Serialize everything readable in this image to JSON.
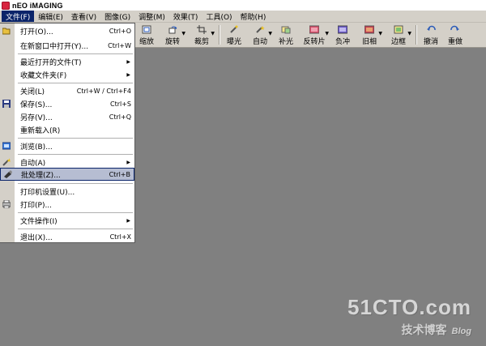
{
  "app": {
    "title": "nEO iMAGING"
  },
  "menubar": [
    {
      "label": "文件(F)",
      "active": true
    },
    {
      "label": "编辑(E)"
    },
    {
      "label": "查看(V)"
    },
    {
      "label": "图像(G)"
    },
    {
      "label": "调整(M)"
    },
    {
      "label": "效果(T)"
    },
    {
      "label": "工具(O)"
    },
    {
      "label": "帮助(H)"
    }
  ],
  "toolbar": [
    {
      "label": "缩放",
      "icon": "zoom-icon"
    },
    {
      "label": "旋转",
      "icon": "rotate-icon",
      "dropdown": true
    },
    {
      "label": "裁剪",
      "icon": "crop-icon",
      "dropdown": true
    },
    {
      "label": "曝光",
      "icon": "exposure-icon"
    },
    {
      "label": "自动",
      "icon": "auto-fix-icon",
      "dropdown": true
    },
    {
      "label": "补光",
      "icon": "fill-light-icon"
    },
    {
      "label": "反转片",
      "icon": "reversal-film-icon",
      "dropdown": true
    },
    {
      "label": "负冲",
      "icon": "cross-process-icon"
    },
    {
      "label": "旧相",
      "icon": "old-photo-icon",
      "dropdown": true
    },
    {
      "label": "边框",
      "icon": "border-icon",
      "dropdown": true
    },
    {
      "label": "撤消",
      "icon": "undo-icon"
    },
    {
      "label": "重做",
      "icon": "redo-icon"
    }
  ],
  "file_menu": {
    "items": [
      {
        "label": "打开(O)...",
        "shortcut": "Ctrl+O",
        "icon": "open-folder-icon"
      },
      {
        "label": "在新窗口中打开(Y)...",
        "shortcut": "Ctrl+W"
      },
      {
        "label": "最近打开的文件(T)",
        "submenu": true
      },
      {
        "label": "收藏文件夹(F)",
        "submenu": true
      },
      {
        "label": "关闭(L)",
        "shortcut": "Ctrl+W  /  Ctrl+F4"
      },
      {
        "label": "保存(S)...",
        "shortcut": "Ctrl+S",
        "icon": "save-icon"
      },
      {
        "label": "另存(V)...",
        "shortcut": "Ctrl+Q"
      },
      {
        "label": "重新载入(R)"
      },
      {
        "label": "浏览(B)...",
        "icon": "browse-icon"
      },
      {
        "label": "自动(A)",
        "submenu": true,
        "icon": "auto-icon"
      },
      {
        "label": "批处理(Z)...",
        "shortcut": "Ctrl+B",
        "icon": "batch-icon",
        "highlighted": true
      },
      {
        "label": "打印机设置(U)..."
      },
      {
        "label": "打印(P)...",
        "icon": "print-icon"
      },
      {
        "label": "文件操作(I)",
        "submenu": true
      },
      {
        "label": "退出(X)...",
        "shortcut": "Ctrl+X"
      }
    ]
  },
  "watermark": {
    "main": "51CTO.com",
    "sub": "技术博客",
    "blog": "Blog"
  },
  "colors": {
    "menu_highlight": "#0a246a",
    "item_highlight": "#b6bdd2",
    "workspace": "#808080",
    "chrome": "#d4d0c8"
  }
}
